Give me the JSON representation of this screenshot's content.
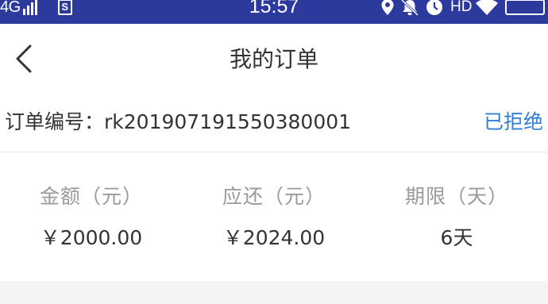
{
  "status_bar": {
    "network": "4G",
    "time": "15:57",
    "hd": "HD",
    "icons": [
      "signal-icon",
      "sim-icon",
      "location-icon",
      "mute-icon",
      "alarm-icon",
      "wifi-icon",
      "battery-icon"
    ],
    "sim_glyph": "S"
  },
  "nav": {
    "title": "我的订单",
    "back_icon": "chevron-left-icon"
  },
  "order": {
    "number_label": "订单编号：rk201907191550380001",
    "status": "已拒绝"
  },
  "stats": [
    {
      "label": "金额（元）",
      "value": "￥2000.00"
    },
    {
      "label": "应还（元）",
      "value": "￥2024.00"
    },
    {
      "label": "期限（天）",
      "value": "6天"
    }
  ],
  "colors": {
    "status_bar_bg": "#2c3a9e",
    "status_accent": "#2f7fd6",
    "label_gray": "#9a9a9a",
    "text": "#333333",
    "background_gray": "#f4f4f4"
  }
}
